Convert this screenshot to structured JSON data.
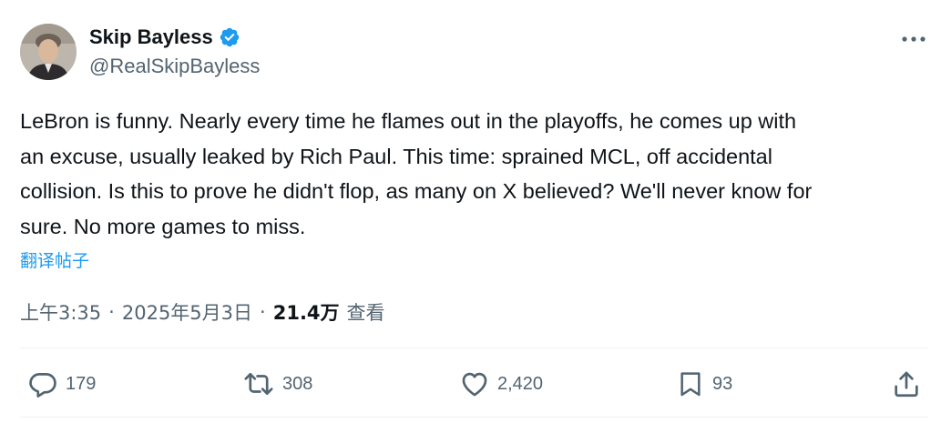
{
  "author": {
    "display_name": "Skip Bayless",
    "handle": "@RealSkipBayless"
  },
  "tweet": {
    "text": "LeBron is funny. Nearly every time he flames out in the playoffs, he comes up with\nan excuse, usually leaked by Rich Paul. This time: sprained MCL, off accidental\ncollision. Is this to prove he didn't flop, as many on X believed? We'll never know for\nsure. No more games to miss.",
    "translate_label": "翻译帖子"
  },
  "meta": {
    "time": "上午3:35",
    "separator_1": "·",
    "date": "2025年5月3日",
    "separator_2": "·",
    "views_count": "21.4万",
    "views_label": "查看"
  },
  "actions": {
    "replies": "179",
    "reposts": "308",
    "likes": "2,420",
    "bookmarks": "93"
  },
  "colors": {
    "accent": "#1d9bf0",
    "text_primary": "#0f1419",
    "text_secondary": "#536471"
  },
  "icons": {
    "verified": "verified-badge-icon",
    "more": "more-horizontal-icon",
    "reply": "reply-icon",
    "repost": "repost-icon",
    "like": "heart-icon",
    "bookmark": "bookmark-icon",
    "share": "share-icon"
  }
}
